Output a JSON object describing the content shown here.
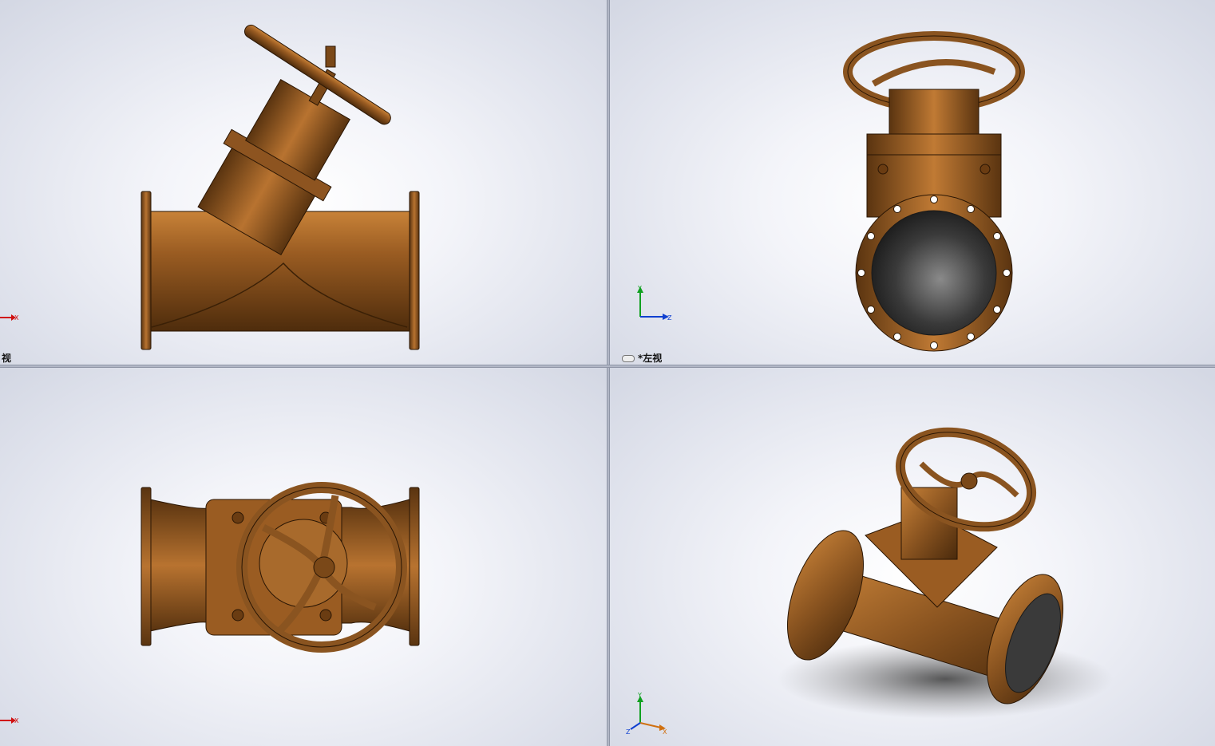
{
  "viewports": {
    "front": {
      "label": "视"
    },
    "left": {
      "label": "*左视"
    },
    "top": {
      "label": ""
    },
    "iso": {
      "label": ""
    }
  },
  "triad": {
    "x": "X",
    "y": "Y",
    "z": "Z"
  },
  "colors": {
    "bronze": "#8a5420",
    "bronze_dark": "#4a2a0c",
    "bronze_light": "#c07a34",
    "bore": "#3a3a3a"
  },
  "icons": [
    "triad-icon",
    "link-view-icon"
  ]
}
